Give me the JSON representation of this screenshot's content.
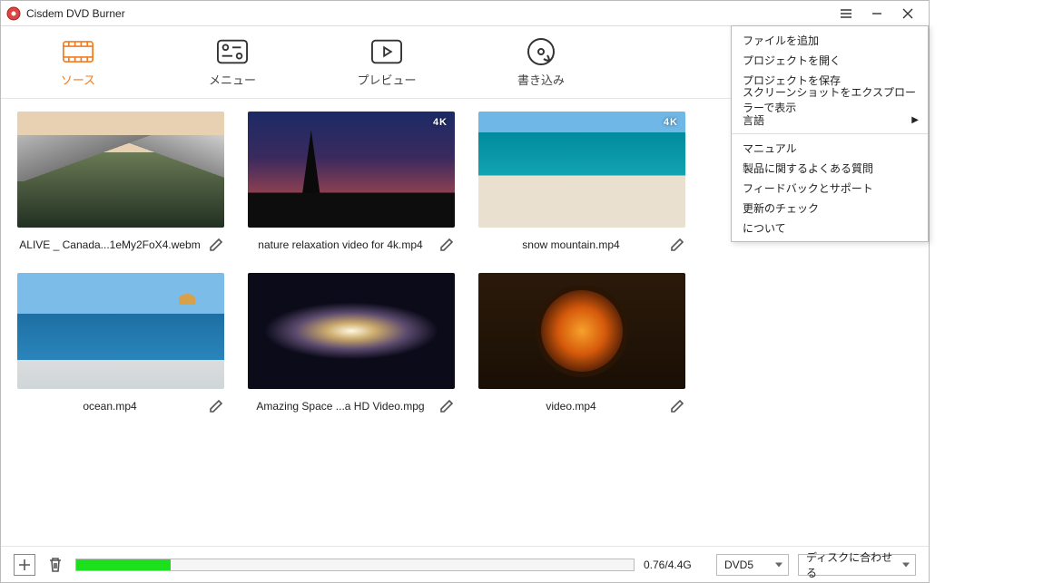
{
  "title": "Cisdem DVD Burner",
  "tabs": [
    {
      "label": "ソース"
    },
    {
      "label": "メニュー"
    },
    {
      "label": "プレビュー"
    },
    {
      "label": "書き込み"
    }
  ],
  "items": [
    {
      "name": "ALIVE _ Canada...1eMy2FoX4.webm",
      "badge": "",
      "thumb": "t-mountain"
    },
    {
      "name": "nature relaxation video for 4k.mp4",
      "badge": "4K",
      "thumb": "t-night"
    },
    {
      "name": "snow mountain.mp4",
      "badge": "4K",
      "thumb": "t-beach"
    },
    {
      "name": "ocean.mp4",
      "badge": "",
      "thumb": "t-ocean"
    },
    {
      "name": "Amazing Space ...a HD Video.mpg",
      "badge": "",
      "thumb": "t-galaxy"
    },
    {
      "name": "video.mp4",
      "badge": "",
      "thumb": "t-arch"
    }
  ],
  "progress": {
    "percent": 17,
    "label": "0.76/4.4G"
  },
  "disc_type": "DVD5",
  "fit_mode": "ディスクに合わせる",
  "menu": {
    "items1": [
      "ファイルを追加",
      "プロジェクトを開く",
      "プロジェクトを保存",
      "スクリーンショットをエクスプローラーで表示"
    ],
    "language": "言語",
    "items2": [
      "マニュアル",
      "製品に関するよくある質問",
      "フィードバックとサポート",
      "更新のチェック",
      "について"
    ]
  }
}
